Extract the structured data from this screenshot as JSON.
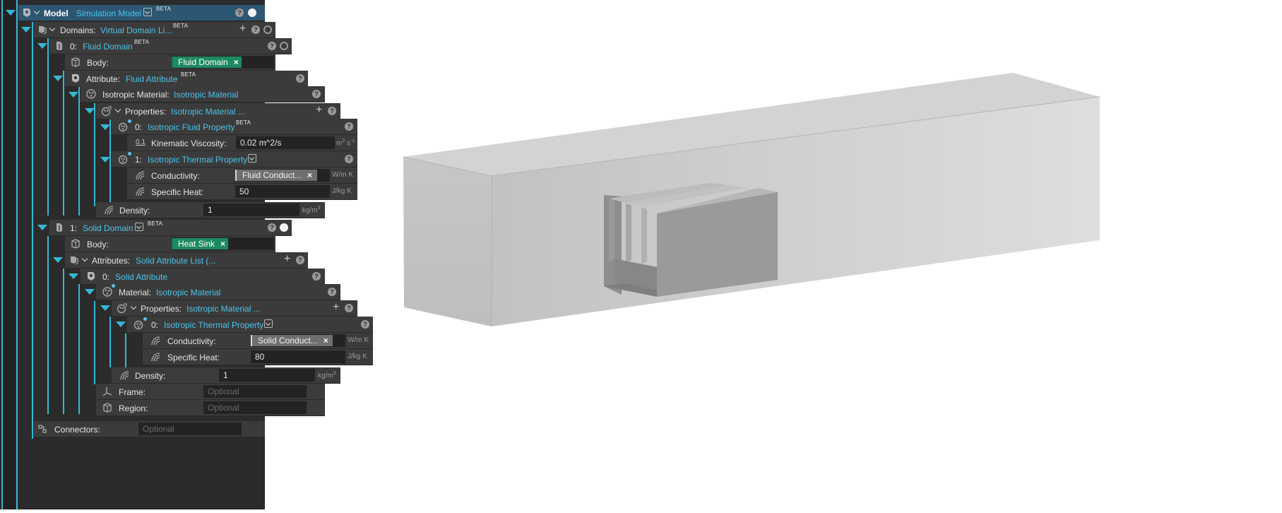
{
  "model_row": {
    "title": "Model",
    "link": "Simulation Model",
    "beta": "BETA",
    "help": "?"
  },
  "domains_row": {
    "label": "Domains:",
    "link": "Virtual Domain Li...",
    "beta": "BETA",
    "add": "+",
    "help": "?"
  },
  "fluid_domain": {
    "index": "0:",
    "link": "Fluid Domain",
    "beta": "BETA",
    "body": {
      "label": "Body:",
      "chip": "Fluid Domain",
      "remove": "×"
    },
    "attribute": {
      "label": "Attribute:",
      "link": "Fluid Attribute",
      "beta": "BETA"
    },
    "material": {
      "label": "Isotropic Material:",
      "link": "Isotropic Material"
    },
    "properties": {
      "label": "Properties:",
      "link": "Isotropic Material ...",
      "add": "+"
    },
    "fluid_property": {
      "index": "0:",
      "link": "Isotropic Fluid Property",
      "beta": "BETA"
    },
    "viscosity": {
      "icon_text": "0.1",
      "label": "Kinematic Viscosity:",
      "value": "0.02 m^2/s",
      "unit_base": "m",
      "unit_sup": "2",
      "unit_mid": " s",
      "unit_sup2": "-1"
    },
    "thermal_property": {
      "index": "1:",
      "link": "Isotropic Thermal Property"
    },
    "conductivity": {
      "label": "Conductivity:",
      "chip": "Fluid Conduct...",
      "remove": "×",
      "unit": "W/m K"
    },
    "specific_heat": {
      "label": "Specific Heat:",
      "value": "50",
      "unit": "J/kg K"
    },
    "density": {
      "label": "Density:",
      "value": "1",
      "unit_base": "kg/m",
      "unit_sup": "3"
    }
  },
  "solid_domain": {
    "index": "1:",
    "link": "Solid Domain",
    "beta": "BETA",
    "body": {
      "label": "Body:",
      "chip": "Heat Sink",
      "remove": "×"
    },
    "attributes": {
      "label": "Attributes:",
      "link": "Solid Attribute List (...",
      "add": "+"
    },
    "attribute": {
      "index": "0:",
      "link": "Solid Attribute"
    },
    "material": {
      "label": "Material:",
      "link": "Isotropic Material"
    },
    "properties": {
      "label": "Properties:",
      "link": "Isotropic Material ...",
      "add": "+"
    },
    "thermal_property": {
      "index": "0:",
      "link": "Isotropic Thermal Property"
    },
    "conductivity": {
      "label": "Conductivity:",
      "chip": "Solid Conduct...",
      "remove": "×",
      "unit": "W/m K"
    },
    "specific_heat": {
      "label": "Specific Heat:",
      "value": "80",
      "unit": "J/kg K"
    },
    "density": {
      "label": "Density:",
      "value": "1",
      "unit_base": "kg/m",
      "unit_sup": "3"
    },
    "frame": {
      "label": "Frame:",
      "placeholder": "Optional"
    },
    "region": {
      "label": "Region:",
      "placeholder": "Optional"
    }
  },
  "connectors": {
    "label": "Connectors:",
    "placeholder": "Optional"
  },
  "colors": {
    "accent": "#35b8d4",
    "link": "#4cc3ea",
    "chip_green": "#1e8a62",
    "panel": "#3b3b3b"
  },
  "icons": [
    "domain-icon",
    "body-icon",
    "attribute-icon",
    "material-icon",
    "property-icon",
    "frame-icon",
    "region-icon",
    "connectors-icon"
  ]
}
